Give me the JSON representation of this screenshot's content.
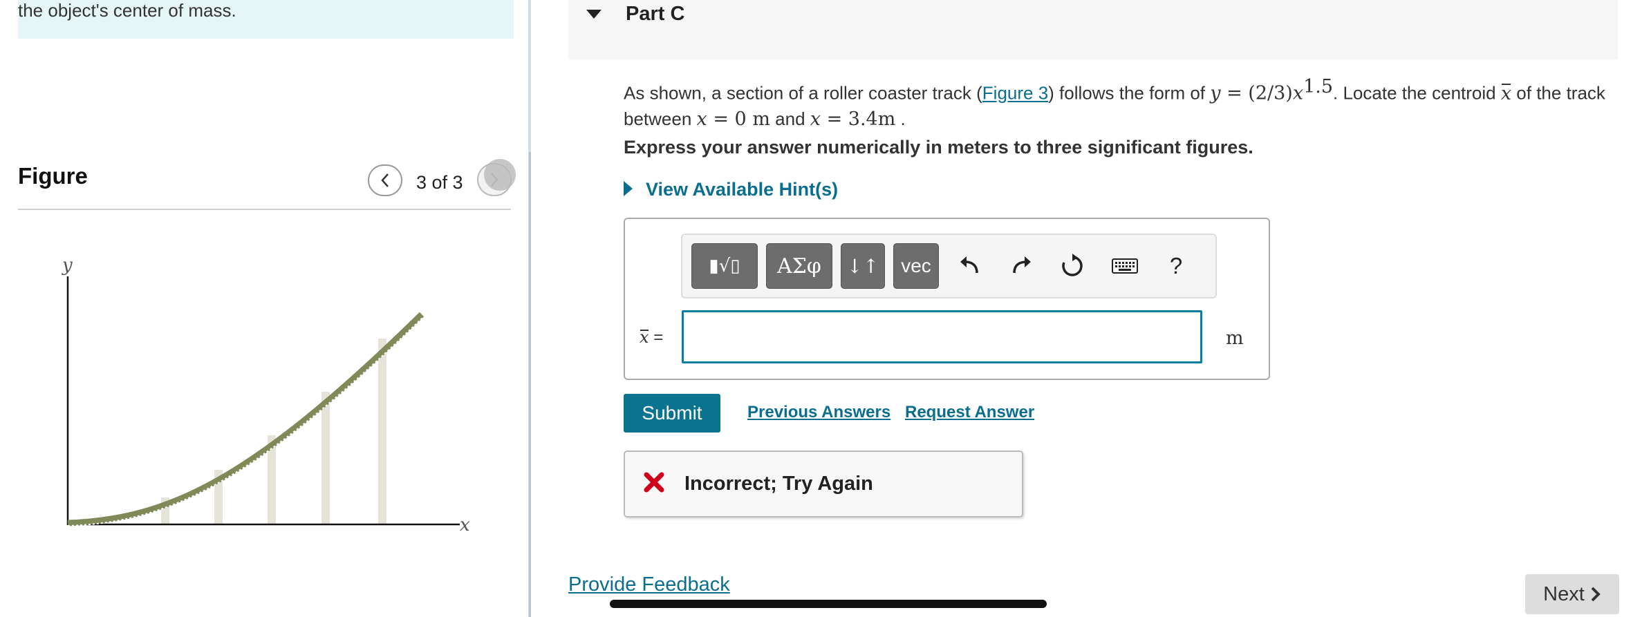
{
  "left_panel": {
    "note_text": "the object's center of mass.",
    "figure_title": "Figure",
    "figure_counter": "3 of 3",
    "figure_axis_y": "y",
    "figure_axis_x": "x"
  },
  "part": {
    "title": "Part C",
    "question_prefix": "As shown, a section of a roller coaster track (",
    "figure_link": "Figure 3",
    "question_mid": ") follows the form of ",
    "equation_lhs": "y",
    "equation_rhs": " = (2/3)",
    "equation_var": "x",
    "equation_exp": "1.5",
    "question_mid2": ". Locate the centroid ",
    "centroid_symbol": "x",
    "question_mid3": " of the track",
    "question_between": "between ",
    "x_start_var": "x",
    "x_start_val": " = 0 m",
    "question_and": " and ",
    "x_end_var": "x",
    "x_end_val": " = 3.4m",
    "question_end": " .",
    "instruction": "Express your answer numerically in meters to three significant figures.",
    "hint_link": "View Available Hint(s)"
  },
  "toolbar": {
    "templates_label": "▮√▯",
    "greek_label": "ΑΣφ",
    "arrows_label": "↓↑",
    "vec_label": "vec",
    "help_label": "?"
  },
  "answer": {
    "label_var": "x",
    "label_eq": " =",
    "value": "",
    "unit": "m"
  },
  "actions": {
    "submit": "Submit",
    "previous_answers": "Previous Answers",
    "request_answer": "Request Answer"
  },
  "feedback": {
    "text": "Incorrect; Try Again",
    "icon_color": "#d0021b"
  },
  "footer": {
    "provide_feedback": "Provide Feedback",
    "next": "Next"
  },
  "colors": {
    "accent": "#0a7490",
    "link": "#0a6e8f",
    "note_bg": "#e6f6f6"
  }
}
